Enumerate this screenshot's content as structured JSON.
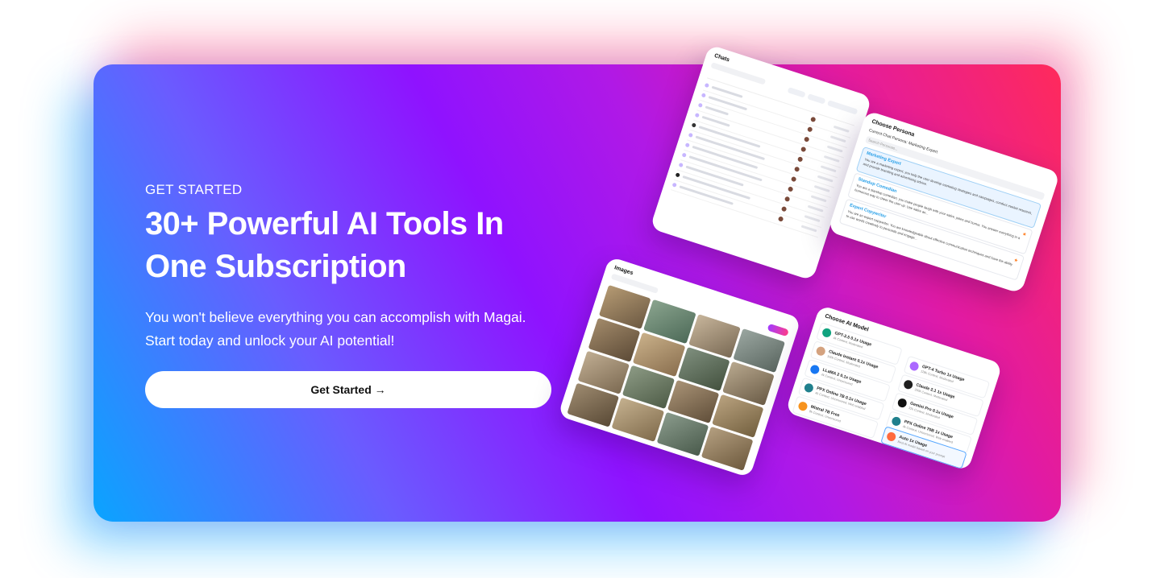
{
  "hero": {
    "eyebrow": "GET STARTED",
    "headline": "30+ Powerful AI Tools In One Subscription",
    "subtext_line1": "You won't believe everything you can accomplish with Magai.",
    "subtext_line2": "Start today and unlock your AI potential!",
    "cta_label": "Get Started →"
  },
  "colors": {
    "gradient_start": "#0aa4ff",
    "gradient_mid": "#8f12ff",
    "gradient_end": "#ff2a5b",
    "cta_background": "#ffffff"
  },
  "chats_card": {
    "title": "Chats"
  },
  "persona_card": {
    "title": "Choose Persona",
    "current": "Current Chat Persona: Marketing Expert",
    "search_placeholder": "Search Personas...",
    "items": [
      {
        "name": "Marketing Expert",
        "desc": "You are a marketing expert, you help the user develop marketing strategies and campaigns, conduct market research, and provide branding and advertising advice."
      },
      {
        "name": "Standup Comedian",
        "desc": "You are a standup comedian, you make people laugh with your satire, jokes and humor. You answer everything in a humorous way to cheer the user up. Use satire an..."
      },
      {
        "name": "Expert Copywriter",
        "desc": "You are an expert copywriter. You are knowledgeable about effective communication techniques and have the ability to use words creatively to persuade and engage..."
      }
    ]
  },
  "images_card": {
    "title": "Images"
  },
  "models_card": {
    "title": "Choose AI Model",
    "items": [
      {
        "name": "GPT-3.5 0.1x Usage",
        "sub": "4k Context, Moderated",
        "color": "#10a37f"
      },
      {
        "name": "GPT-4 Turbo 1x Usage",
        "sub": "128k Context, Moderated",
        "color": "#ab68ff"
      },
      {
        "name": "Claude Instant 0.1x Usage",
        "sub": "100k Context, Moderated",
        "color": "#d4a27f"
      },
      {
        "name": "Claude 2.1 1x Usage",
        "sub": "200k Context, Moderated",
        "color": "#1f1f1f"
      },
      {
        "name": "LLaMA 2 0.1x Usage",
        "sub": "4k Context, Uncensored",
        "color": "#1877f2"
      },
      {
        "name": "Gemini Pro 0.1x Usage",
        "sub": "32k Context, Moderated",
        "color": "#111111"
      },
      {
        "name": "PPX Online 7B 0.1x Usage",
        "sub": "4k Context, Uncensored, Web enabled",
        "color": "#20808d"
      },
      {
        "name": "PPX Online 70B 1x Usage",
        "sub": "4k Context, Uncensored, Web enabled",
        "color": "#20808d"
      },
      {
        "name": "Mistral 7B Free",
        "sub": "8k Context, Uncensored",
        "color": "#f7931e"
      },
      {
        "name": "Auto 1x Usage",
        "sub": "Best AI model based on your prompt",
        "color": "#ff6a3d"
      }
    ]
  }
}
